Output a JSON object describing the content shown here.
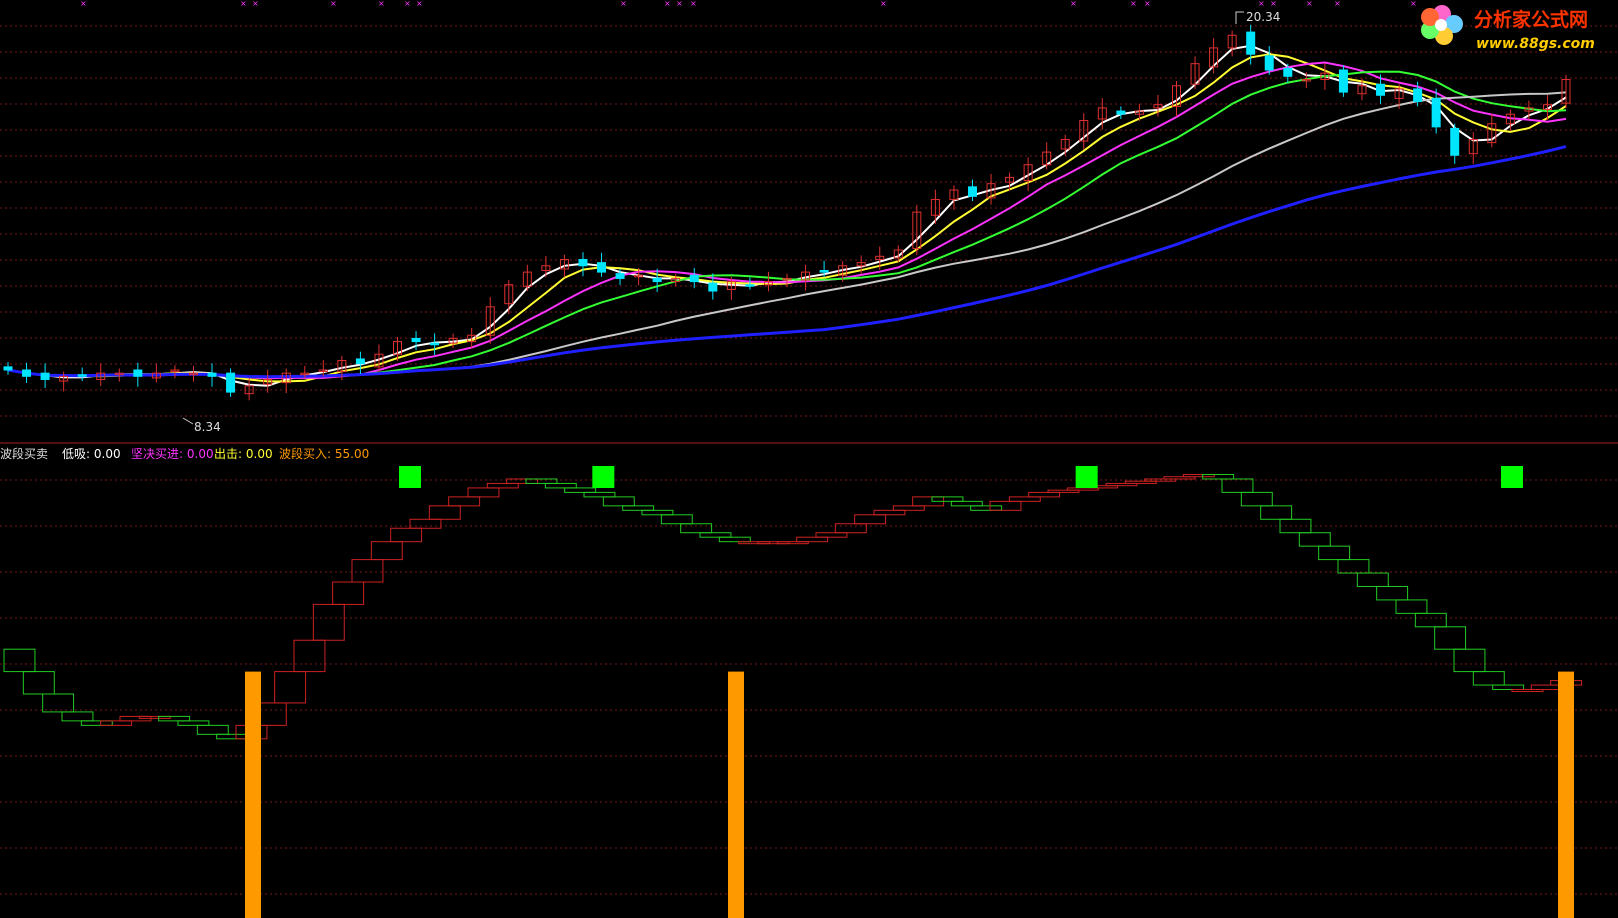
{
  "watermark": {
    "brand": "分析家公式网",
    "url": "www.88gs.com"
  },
  "colors": {
    "background": "#000000",
    "grid": "#7a1a1a",
    "candle_up": "#e03030",
    "candle_down": "#00e5ff",
    "ma_white": "#ffffff",
    "ma_yellow": "#ffff33",
    "ma_magenta": "#ff33ff",
    "ma_green": "#33ff33",
    "ma_gray": "#c8c8c8",
    "ma_blue": "#1f1fff",
    "wave_up": "#cc2222",
    "wave_down": "#22cc22",
    "signal_square": "#00ff00",
    "buy_bar": "#ff9900",
    "divider": "#aa2222"
  },
  "price_panel": {
    "max_label": "20.34",
    "min_label": "8.34"
  },
  "indicator_panel": {
    "title": "波段买卖",
    "fields": [
      {
        "label": "低吸",
        "value": "0.00",
        "color": "#ffffff"
      },
      {
        "label": "坚决买进",
        "value": "0.00",
        "color": "#ff33ff"
      },
      {
        "label": "出击",
        "value": "0.00",
        "color": "#ffff33"
      },
      {
        "label": "波段买入",
        "value": "55.00",
        "color": "#ff9900"
      }
    ]
  },
  "chart_data": [
    {
      "type": "candlestick",
      "title": "",
      "y_range": [
        7.6,
        20.9
      ],
      "annotations": [
        {
          "text": "20.34",
          "value": 20.34,
          "kind": "high"
        },
        {
          "text": "8.34",
          "value": 8.34,
          "kind": "low"
        }
      ],
      "close_approx": [
        9.5,
        9.3,
        9.2,
        9.3,
        9.3,
        9.4,
        9.4,
        9.3,
        9.4,
        9.5,
        9.4,
        9.3,
        8.8,
        9.0,
        9.2,
        9.4,
        9.4,
        9.5,
        9.8,
        9.7,
        10.0,
        10.4,
        10.4,
        10.3,
        10.5,
        10.6,
        11.5,
        12.2,
        12.6,
        12.8,
        13.0,
        12.8,
        12.6,
        12.4,
        12.5,
        12.3,
        12.4,
        12.3,
        12.0,
        12.3,
        12.2,
        12.3,
        12.4,
        12.6,
        12.6,
        12.8,
        12.9,
        13.1,
        13.3,
        14.5,
        14.9,
        15.2,
        15.0,
        15.4,
        15.6,
        16.0,
        16.4,
        16.8,
        17.4,
        17.8,
        17.6,
        17.7,
        17.9,
        18.5,
        19.2,
        19.7,
        20.1,
        19.5,
        19.0,
        18.8,
        18.7,
        18.9,
        18.3,
        18.5,
        18.2,
        18.4,
        18.0,
        17.2,
        16.3,
        16.8,
        17.3,
        17.6,
        17.8,
        17.9,
        18.7
      ],
      "moving_averages": [
        {
          "color": "white",
          "values_approx": {
            "start": 9.4,
            "end": 18.0
          }
        },
        {
          "color": "yellow",
          "values_approx": {
            "start": 9.3,
            "end": 17.6
          }
        },
        {
          "color": "magenta",
          "values_approx": {
            "start": 9.3,
            "end": 17.7
          }
        },
        {
          "color": "green",
          "values_approx": {
            "start": 9.3,
            "end": 18.0
          }
        },
        {
          "color": "gray",
          "values_approx": {
            "start": 9.4,
            "end": 17.8
          }
        },
        {
          "color": "blue",
          "values_approx": {
            "start": 9.4,
            "end": 16.3
          }
        }
      ]
    },
    {
      "type": "bar",
      "title": "波段买卖",
      "y_range": [
        0,
        100
      ],
      "wave_values_approx": [
        60,
        55,
        50,
        46,
        44,
        43,
        44,
        45,
        45,
        44,
        43,
        41,
        40,
        43,
        48,
        55,
        62,
        70,
        75,
        80,
        84,
        87,
        89,
        92,
        94,
        96,
        97,
        98,
        97,
        96,
        95,
        94,
        92,
        91,
        90,
        88,
        86,
        85,
        84,
        84,
        84,
        84,
        85,
        86,
        88,
        90,
        91,
        92,
        94,
        93,
        92,
        91,
        93,
        94,
        95,
        95.5,
        96,
        96.5,
        97,
        97.5,
        98,
        98.5,
        99,
        98,
        95,
        92,
        89,
        86,
        83,
        80,
        77,
        74,
        71,
        68,
        65,
        60,
        55,
        52,
        51,
        51,
        52,
        53
      ],
      "signal_squares_category_index": [
        21,
        31,
        56,
        78
      ],
      "buy_bars": [
        {
          "label": "波段买入",
          "value": 55,
          "category_index": 15
        },
        {
          "label": "波段买入",
          "value": 55,
          "category_index": 45
        },
        {
          "label": "波段买入",
          "value": 55,
          "category_index": 97
        }
      ]
    }
  ]
}
